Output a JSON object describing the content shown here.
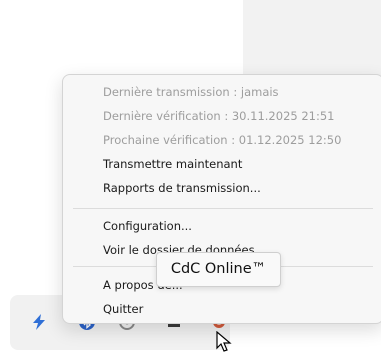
{
  "menu": {
    "status": {
      "last_transmission": "Dernière transmission : jamais",
      "last_check": "Dernière vérification : 30.11.2025 21:51",
      "next_check": "Prochaine vérification : 01.12.2025 12:50"
    },
    "transmit_now": "Transmettre maintenant",
    "transmission_reports": "Rapports de transmission...",
    "configuration": "Configuration...",
    "view_data_folder": "Voir le dossier de données",
    "about": "A propos de...",
    "quit": "Quitter"
  },
  "tooltip": {
    "text": "CdC Online™"
  },
  "tray": {
    "icons": [
      "lightning-icon",
      "bluetooth-icon",
      "network-icon",
      "app-icon",
      "cdc-online-icon"
    ]
  }
}
